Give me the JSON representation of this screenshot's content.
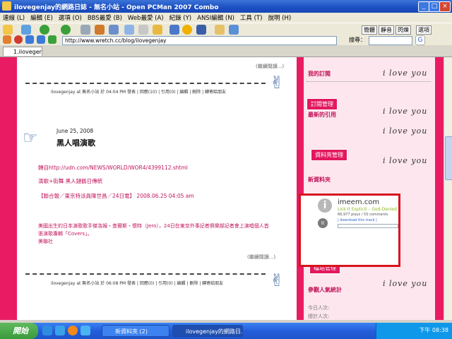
{
  "window": {
    "title": "ilovegenjay的網路日誌 - 無名小站 - Open PCMan 2007 Combo"
  },
  "menu": [
    "連線 (L)",
    "編輯 (E)",
    "選項 (O)",
    "BBS最愛 (B)",
    "Web最愛 (A)",
    "紀錄 (Y)",
    "ANSI編輯 (N)",
    "工具 (T)",
    "說明 (H)"
  ],
  "toolbar": {
    "opt1": "簡體",
    "opt2": "靜音",
    "opt3": "閃爍",
    "opt4": "選項"
  },
  "address": {
    "url": "http://www.wretch.cc/blog/ilovegenjay",
    "search_label": "搜尋："
  },
  "tab": {
    "label": "1.ilovegenjay"
  },
  "post1": {
    "continue_label": "(繼續閱讀...)",
    "meta": "ilovegenjay at 無名小站 於 04:04 PM 發表 | 回應(10) | 引用(0) | 編輯 | 刪除 | 轉寄給朋友"
  },
  "post2": {
    "date": "June 25, 2008",
    "title": "黑人唱演歌",
    "source": "轉自http://udn.com/NEWS/WORLD/WOR4/4399112.shtml",
    "line1": "演歌+街舞 黑人鏈鶴日傳統",
    "line2": "【聯合報／東京特派員陳世昌／24日電】 2008.06.25 04:05 am",
    "body1": "美國出生的日本演歌歌手傑洛姆・查爾斯・懷特（Jero），24日在東京外事記者俱樂部記者會上演唱個人首",
    "body2": "張演歌專輯「Covers」。",
    "body3": "美聯社",
    "continue_label": "(繼續閱讀...)",
    "meta": "ilovegenjay at 無名小站 於 06:08 PM 發表 | 回應(0) | 引用(0) | 編輯 | 刪除 | 轉寄給朋友"
  },
  "sidebar": {
    "my_sub": "我的訂閱",
    "sub_manage": "訂閱管理",
    "latest_cite": "最新的引用",
    "folder_manage": "資料夾管理",
    "new_folder": "新資料夾",
    "site_manage": "檔站管理",
    "popularity": "參觀人氣統計",
    "today": "今日人次: ",
    "total": "總計人次: ",
    "love": "i love you"
  },
  "imeem": {
    "brand": "imeem.com",
    "track": "Lick It Explicit – God-Denied",
    "stats": "66,977 plays / 50 comments",
    "link": "| download this track |"
  },
  "taskbar": {
    "start": "開始",
    "item1": "新資料夾 (2)",
    "item2": "ilovegenjay的網路日...",
    "clock": "下午 08:38"
  },
  "colors": {
    "accent": "#e91c63",
    "highlight": "#d8141e"
  }
}
